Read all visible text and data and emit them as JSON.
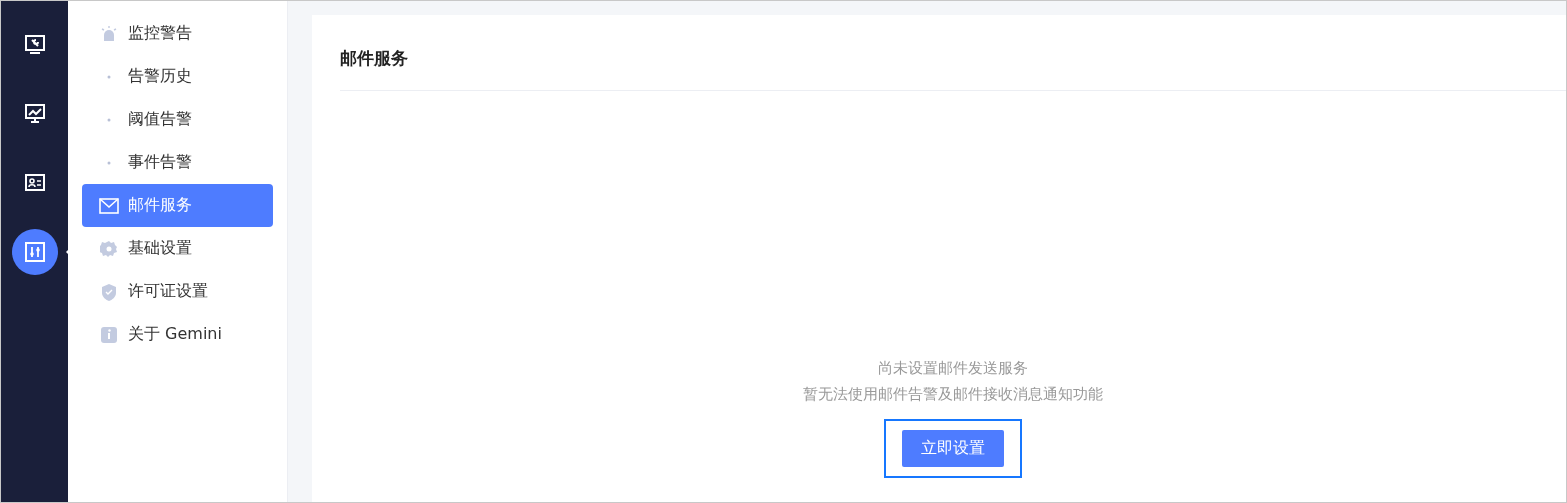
{
  "rail": [
    {
      "selected": false
    },
    {
      "selected": false
    },
    {
      "selected": false
    },
    {
      "selected": true
    }
  ],
  "menu": [
    {
      "kind": "header",
      "label": "监控警告",
      "selected": false
    },
    {
      "kind": "child",
      "label": "告警历史",
      "selected": false
    },
    {
      "kind": "child",
      "label": "阈值告警",
      "selected": false
    },
    {
      "kind": "child",
      "label": "事件告警",
      "selected": false
    },
    {
      "kind": "link",
      "label": "邮件服务",
      "selected": true
    },
    {
      "kind": "link",
      "label": "基础设置",
      "selected": false
    },
    {
      "kind": "link",
      "label": "许可证设置",
      "selected": false
    },
    {
      "kind": "link",
      "label": "关于 Gemini",
      "selected": false
    }
  ],
  "panel": {
    "title": "邮件服务",
    "empty_lines": [
      "尚未设置邮件发送服务",
      "暂无法使用邮件告警及邮件接收消息通知功能"
    ],
    "button": {
      "label": "立即设置",
      "focused": true
    }
  }
}
